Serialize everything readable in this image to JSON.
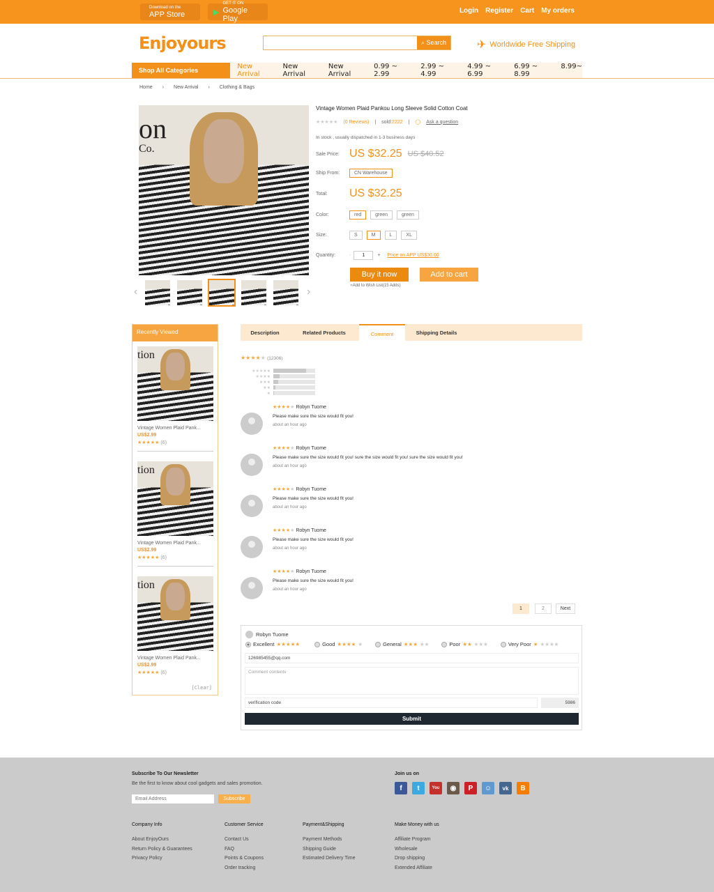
{
  "topbar": {
    "appstore_small": "Download on the",
    "appstore": "APP Store",
    "gplay_small": "GET IT ON",
    "gplay": "Google Play",
    "links": [
      "Login",
      "Register",
      "Cart",
      "My orders"
    ]
  },
  "header": {
    "logo": "Enjoyours",
    "search_placeholder": "",
    "search_button": "Search",
    "shipping": "Worldwide Free Shipping"
  },
  "nav": {
    "all": "Shop All Categories",
    "items": [
      "New Arrival",
      "New Arrival",
      "New Arrival",
      "0.99 ~ 2.99",
      "2.99 ~ 4.99",
      "4.99 ~ 6.99",
      "6.99 ~ 8.99",
      "8.99~"
    ]
  },
  "breadcrumb": [
    "Home",
    "New Arrival",
    "Clothing & Bags"
  ],
  "product": {
    "image_text": "on",
    "image_text2": "Co.",
    "title": "Vintage Women Plaid Pankou Long Sleeve Solid Cotton Coat",
    "reviews": "(0 Reviews)",
    "sold_label": "sold:",
    "sold": "2222",
    "ask": "Ask a question",
    "stock": "In stock , usually dispatched in 1-3 business days",
    "sale_label": "Sale Price:",
    "sale": "US $32.25",
    "old": "US $40.52",
    "ship_label": "Ship From:",
    "ship": "CN Warehouse",
    "total_label": "Total:",
    "total": "US $32.25",
    "color_label": "Color:",
    "colors": [
      "red",
      "green",
      "green"
    ],
    "size_label": "Size:",
    "sizes": [
      "S",
      "M",
      "L",
      "XL"
    ],
    "qty_label": "Quantity:",
    "qty": "1",
    "app_price_label": "Price on APP",
    "app_price": "US$30.00",
    "buy": "Buy it now",
    "cart": "Add to cart",
    "wish": "Add to Wish List(15 Adds)"
  },
  "recent": {
    "title": "Recently Viewed",
    "items": [
      {
        "image_text": "tion",
        "name": "Vintage Women Plaid Pank...",
        "price": "US$2.99",
        "count": "(6)"
      },
      {
        "image_text": "tion",
        "name": "Vintage Women Plaid Pank...",
        "price": "US$2.99",
        "count": "(6)"
      },
      {
        "image_text": "tion",
        "name": "Vintage Women Plaid Pank...",
        "price": "US$2.99",
        "count": "(6)"
      }
    ],
    "clear": "[Clear]"
  },
  "tabs": [
    "Description",
    "Related Products",
    "Comment",
    "Shipping Details"
  ],
  "rating": {
    "stars": 4,
    "count": "(12306)",
    "distribution": [
      0.78,
      0.15,
      0.12,
      0.05,
      0.02
    ]
  },
  "reviews": [
    {
      "name": "Robyn Tuome",
      "stars": 4,
      "text": "Please make sure the size would fit you!",
      "time": "about an hour ago"
    },
    {
      "name": "Robyn Tuome",
      "stars": 4,
      "text": "Please make sure the size would fit you! sure the size would fit you! sure the size would fit you!",
      "time": "about an hour ago"
    },
    {
      "name": "Robyn Tuome",
      "stars": 4,
      "text": "Please make sure the size would fit you!",
      "time": "about an hour ago"
    },
    {
      "name": "Robyn Tuome",
      "stars": 4,
      "text": "Please make sure the size would fit you!",
      "time": "about an hour ago"
    },
    {
      "name": "Robyn Tuome",
      "stars": 4,
      "text": "Please make sure the size would fit you!",
      "time": "about an hour ago"
    }
  ],
  "pagination": [
    "1",
    "2",
    "Next"
  ],
  "form": {
    "user": "Robyn Tuome",
    "ratings": [
      "Excellent",
      "Good",
      "General",
      "Poor",
      "Very Poor"
    ],
    "email": "126985455@qq.com",
    "comment_placeholder": "Comment contentv",
    "code_placeholder": "verification code",
    "captcha": "5986",
    "submit": "Submit"
  },
  "footer": {
    "newsletter_title": "Subscribe To Our Newsletter",
    "newsletter_text": "Be the first to know about cool gadgets and sales promotion.",
    "email_placeholder": "Email Address",
    "subscribe": "Subscribe",
    "join": "Join us on",
    "columns": [
      {
        "title": "Company Info",
        "links": [
          "About EnjoyOurs",
          "Return Policy & Guarantees",
          "Privacy Policy"
        ]
      },
      {
        "title": "Customer Service",
        "links": [
          "Contact Us",
          "FAQ",
          "Points & Coupons",
          "Order tracking"
        ]
      },
      {
        "title": "Payment&Shipping",
        "links": [
          "Payment Methods",
          "Shipping Guide",
          "Estimated Delivery Time"
        ]
      },
      {
        "title": "Make Money with us",
        "links": [
          "Affiliate Program",
          "Wholesale",
          "Drop shipping",
          "Extended Affiliate"
        ]
      }
    ]
  },
  "colors": {
    "accent": "#f39019",
    "tab_bg": "#fde9cf",
    "footer": "#cbcbcb",
    "submit": "#1f2730"
  }
}
